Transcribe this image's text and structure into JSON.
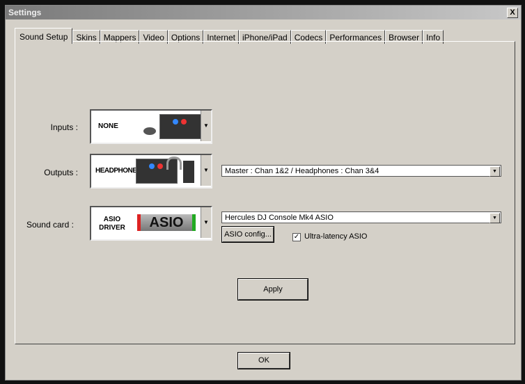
{
  "window": {
    "title": "Settings",
    "close": "X"
  },
  "tabs": [
    "Sound Setup",
    "Skins",
    "Mappers",
    "Video",
    "Options",
    "Internet",
    "iPhone/iPad",
    "Codecs",
    "Performances",
    "Browser",
    "Info"
  ],
  "inputs": {
    "label": "Inputs :",
    "value": "NONE"
  },
  "outputs": {
    "label": "Outputs :",
    "value": "HEADPHONES",
    "routing": "Master : Chan 1&2 / Headphones : Chan 3&4"
  },
  "soundcard": {
    "label": "Sound card :",
    "value_line1": "ASIO",
    "value_line2": "DRIVER",
    "logo": "ASIO",
    "device": "Hercules DJ Console Mk4 ASIO",
    "config_button": "ASIO config...",
    "ultra_latency_label": "Ultra-latency ASIO",
    "ultra_latency_checked": true
  },
  "apply": "Apply",
  "ok": "OK",
  "icons": {
    "dropdown": "▼",
    "check": "✓"
  }
}
